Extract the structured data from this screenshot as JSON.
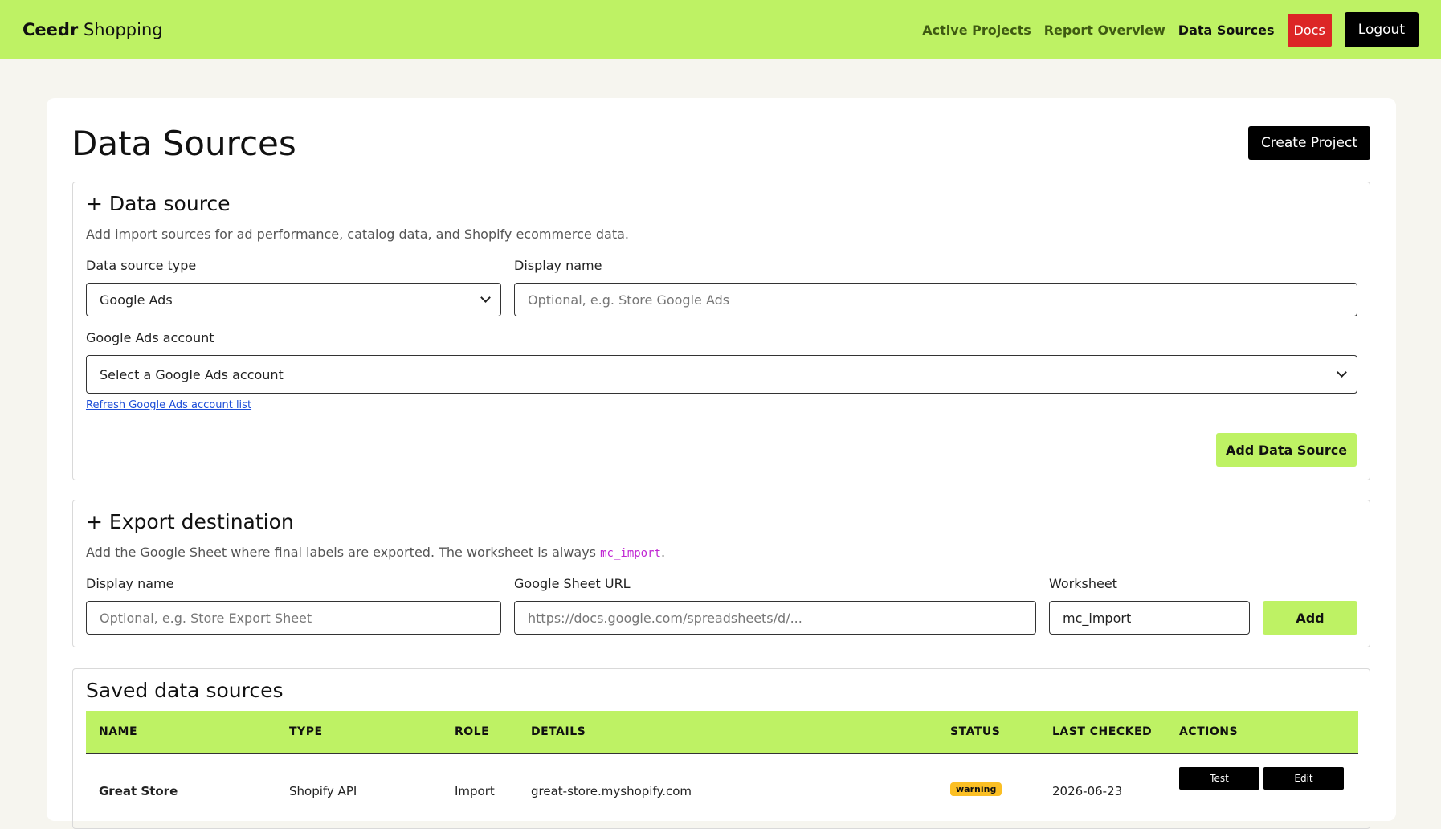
{
  "header": {
    "brand_bold": "Ceedr",
    "brand_rest": " Shopping",
    "nav": [
      "Active Projects",
      "Report Overview",
      "Data Sources"
    ],
    "docs": "Docs",
    "logout": "Logout"
  },
  "page": {
    "title": "Data Sources",
    "create_button": "Create Project"
  },
  "data_source_panel": {
    "title": "+ Data source",
    "description": "Add import sources for ad performance, catalog data, and Shopify ecommerce data.",
    "type_label": "Data source type",
    "type_value": "Google Ads",
    "display_name_label": "Display name",
    "display_name_placeholder": "Optional, e.g. Store Google Ads",
    "account_label": "Google Ads account",
    "account_value": "Select a Google Ads account",
    "refresh_link": "Refresh Google Ads account list",
    "add_button": "Add Data Source"
  },
  "export_panel": {
    "title": "+ Export destination",
    "description_pre": "Add the Google Sheet where final labels are exported. The worksheet is always ",
    "description_code": "mc_import",
    "description_post": ".",
    "display_name_label": "Display name",
    "display_name_placeholder": "Optional, e.g. Store Export Sheet",
    "sheet_url_label": "Google Sheet URL",
    "sheet_url_placeholder": "https://docs.google.com/spreadsheets/d/...",
    "worksheet_label": "Worksheet",
    "worksheet_value": "mc_import",
    "add_button": "Add"
  },
  "saved_panel": {
    "title": "Saved data sources",
    "columns": [
      "NAME",
      "TYPE",
      "ROLE",
      "DETAILS",
      "STATUS",
      "LAST CHECKED",
      "ACTIONS"
    ],
    "rows": [
      {
        "name": "Great Store",
        "type": "Shopify API",
        "role": "Import",
        "details": "great-store.myshopify.com",
        "status": "warning",
        "last_checked": "2026-06-23",
        "actions": [
          "Test",
          "Edit"
        ]
      }
    ]
  }
}
